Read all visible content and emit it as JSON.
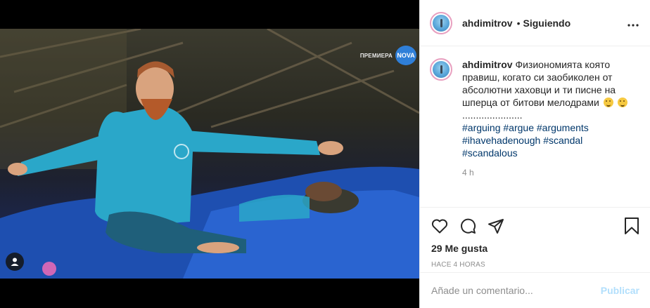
{
  "post": {
    "username": "ahdimitrov",
    "follow_status": "Siguiendo",
    "separator": "•",
    "more_label": "•••"
  },
  "media": {
    "premiere_label": "ПРЕМИЕРА",
    "channel_logo_text": "NOVA"
  },
  "caption": {
    "username": "ahdimitrov",
    "text": "Физиономията която правиш, когато си заобиколен от абсолютни хаховци и ти писне на шперца от битови мелодрами",
    "dots": "......................",
    "hashtags": [
      "#arguing",
      "#argue",
      "#arguments",
      "#ihavehadenough",
      "#scandal",
      "#scandalous"
    ],
    "time": "4 h"
  },
  "actions": {
    "likes": "29 Me gusta",
    "posted_ago": "HACE 4 HORAS"
  },
  "add_comment": {
    "placeholder": "Añade un comentario...",
    "publish_label": "Publicar"
  },
  "colors": {
    "link": "#00376b",
    "muted": "#8e8e8e",
    "publish_disabled": "#b2dffc",
    "story_ring": "#e8a0c0"
  },
  "icons": [
    "heart-icon",
    "comment-icon",
    "share-icon",
    "bookmark-icon",
    "user-tag-icon",
    "more-options-icon"
  ]
}
